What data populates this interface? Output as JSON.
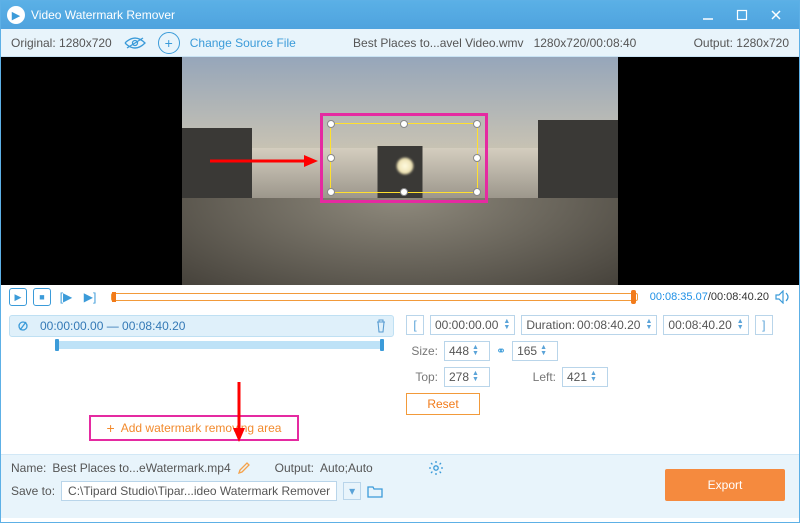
{
  "app": {
    "title": "Video Watermark Remover"
  },
  "toolbar": {
    "original": "Original:  1280x720",
    "change": "Change Source File",
    "filename": "Best Places to...avel Video.wmv",
    "fileinfo": "1280x720/00:08:40",
    "output": "Output:  1280x720"
  },
  "transport": {
    "current": "00:08:35.07",
    "total": "/00:08:40.20"
  },
  "segment": {
    "range": "00:00:00.00 — 00:08:40.20"
  },
  "add": {
    "label": "Add watermark removing area"
  },
  "time": {
    "start": "00:00:00.00",
    "durlabel": "Duration:",
    "dur": "00:08:40.20",
    "end": "00:08:40.20"
  },
  "size": {
    "label": "Size:",
    "w": "448",
    "h": "165"
  },
  "pos": {
    "toplabel": "Top:",
    "top": "278",
    "leftlabel": "Left:",
    "left": "421"
  },
  "reset": "Reset",
  "bottom": {
    "namelabel": "Name:",
    "name": "Best Places to...eWatermark.mp4",
    "outputlabel": "Output:",
    "output": "Auto;Auto",
    "savelabel": "Save to:",
    "save": "C:\\Tipard Studio\\Tipar...ideo Watermark Remover",
    "export": "Export"
  }
}
